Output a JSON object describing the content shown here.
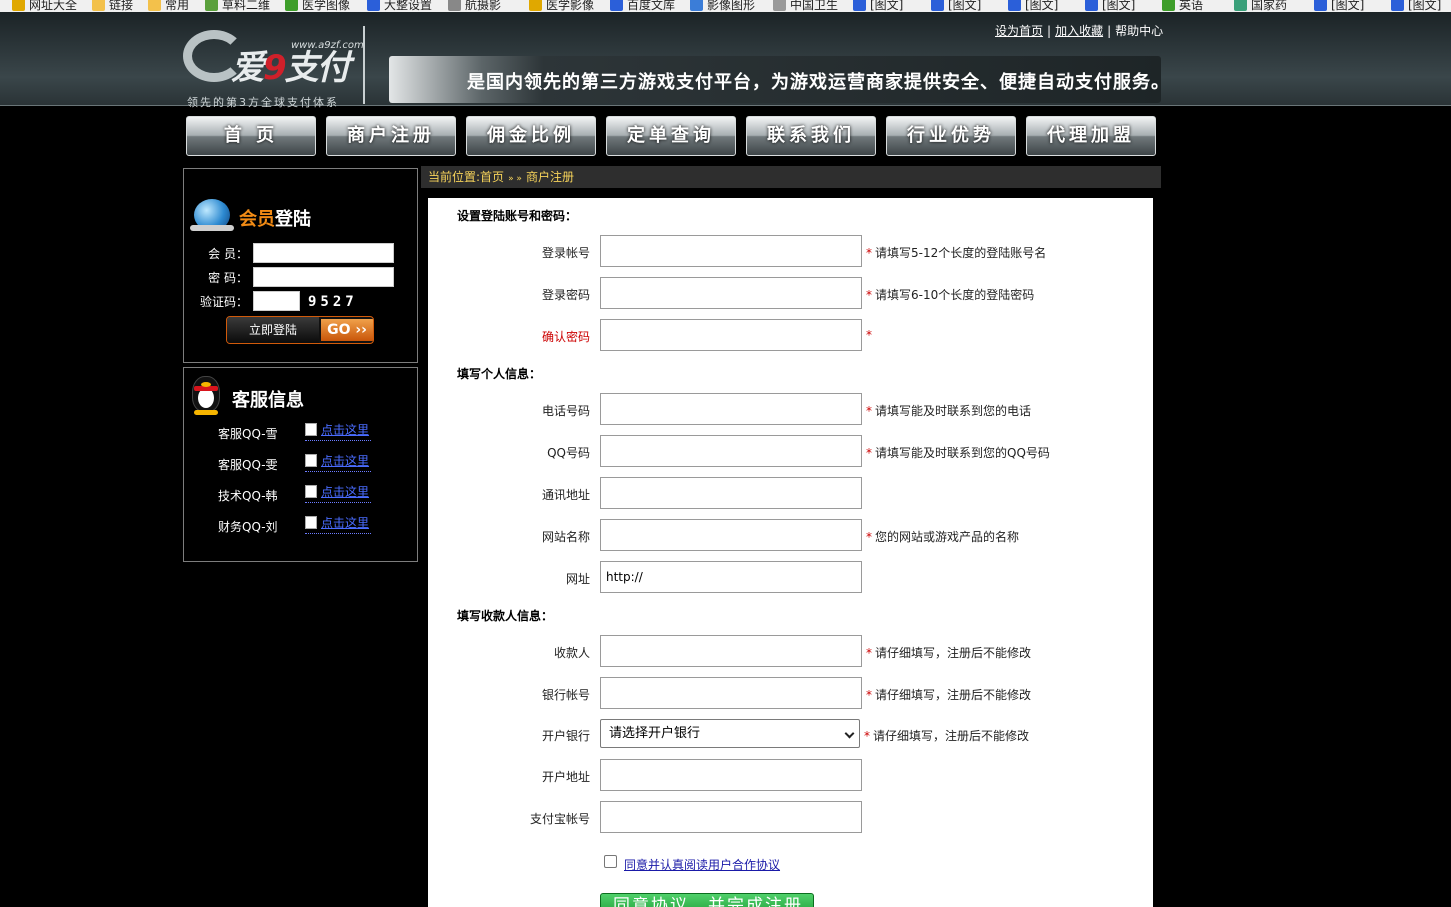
{
  "bookmarks": [
    {
      "label": "网址大全",
      "icon": "globe-icon",
      "color": "#e0a800"
    },
    {
      "label": "链接",
      "icon": "folder-icon",
      "color": "#f3c14b"
    },
    {
      "label": "常用",
      "icon": "folder-icon",
      "color": "#f3c14b"
    },
    {
      "label": "草料二维",
      "icon": "qr-icon",
      "color": "#5aa03c"
    },
    {
      "label": "医学图像",
      "icon": "leaf-icon",
      "color": "#3e9e2a"
    },
    {
      "label": "大整设置",
      "icon": "user-icon",
      "color": "#2b5fd9"
    },
    {
      "label": "航摄影",
      "icon": "disc-icon",
      "color": "#888888"
    },
    {
      "label": "医学影像",
      "icon": "wand-icon",
      "color": "#e0a800"
    },
    {
      "label": "百度文库",
      "icon": "user-icon",
      "color": "#2b5fd9"
    },
    {
      "label": "影像图形",
      "icon": "chart-icon",
      "color": "#3b7dd8"
    },
    {
      "label": "中国卫生",
      "icon": "disc-icon",
      "color": "#999999"
    },
    {
      "label": "[图文]",
      "icon": "user-icon",
      "color": "#2b5fd9"
    },
    {
      "label": "[图文]",
      "icon": "user-icon",
      "color": "#2b5fd9"
    },
    {
      "label": "[图文]",
      "icon": "user-icon",
      "color": "#2b5fd9"
    },
    {
      "label": "[图文]",
      "icon": "user-icon",
      "color": "#2b5fd9"
    },
    {
      "label": "英语",
      "icon": "leaf-icon",
      "color": "#3e9e2a"
    },
    {
      "label": "国家药",
      "icon": "gear-icon",
      "color": "#3aa07a"
    },
    {
      "label": "[图文]",
      "icon": "user-icon",
      "color": "#2b5fd9"
    },
    {
      "label": "[图文]",
      "icon": "user-icon",
      "color": "#2b5fd9"
    }
  ],
  "header": {
    "logo_text_pre": "爱",
    "logo_text_nine": "9",
    "logo_text_post": "支付",
    "logo_url": "www.a9zf.com",
    "logo_slogan": "领先的第3方全球支付体系",
    "links": {
      "home": "设为首页",
      "favorite": "加入收藏",
      "help": "帮助中心",
      "sep": "|"
    },
    "banner_text": "是国内领先的第三方游戏支付平台，为游戏运营商家提供安全、便捷自动支付服务。"
  },
  "nav": [
    "首 页",
    "商户注册",
    "佣金比例",
    "定单查询",
    "联系我们",
    "行业优势",
    "代理加盟"
  ],
  "login_panel": {
    "title_a": "会员",
    "title_b": "登陆",
    "member_label": "会 员：",
    "password_label": "密 码：",
    "captcha_label": "验证码：",
    "captcha_text": "9527",
    "login_button": "立即登陆",
    "go_button": "GO ››"
  },
  "service_panel": {
    "title": "客服信息",
    "items": [
      {
        "label": "客服QQ-雪",
        "link": "点击这里"
      },
      {
        "label": "客服QQ-雯",
        "link": "点击这里"
      },
      {
        "label": "技术QQ-韩",
        "link": "点击这里"
      },
      {
        "label": "财务QQ-刘",
        "link": "点击这里"
      }
    ]
  },
  "breadcrumb": {
    "prefix": "当前位置:",
    "home": "首页",
    "arrow": "» »",
    "current": "商户注册"
  },
  "form": {
    "section1": "设置登陆账号和密码：",
    "section2": "填写个人信息：",
    "section3": "填写收款人信息：",
    "fields": {
      "login_account": {
        "label": "登录帐号",
        "value": "",
        "hint": "请填写5-12个长度的登陆账号名"
      },
      "login_password": {
        "label": "登录密码",
        "value": "",
        "hint": "请填写6-10个长度的登陆密码"
      },
      "confirm_password": {
        "label": "确认密码",
        "value": "",
        "hint": ""
      },
      "phone": {
        "label": "电话号码",
        "value": "",
        "hint": "请填写能及时联系到您的电话"
      },
      "qq": {
        "label": "QQ号码",
        "value": "",
        "hint": "请填写能及时联系到您的QQ号码"
      },
      "address": {
        "label": "通讯地址",
        "value": ""
      },
      "site_name": {
        "label": "网站名称",
        "value": "",
        "hint": "您的网站或游戏产品的名称"
      },
      "site_url": {
        "label": "网址",
        "value": "http://"
      },
      "payee": {
        "label": "收款人",
        "value": "",
        "hint": "请仔细填写，注册后不能修改"
      },
      "bank_account": {
        "label": "银行帐号",
        "value": "",
        "hint": "请仔细填写，注册后不能修改"
      },
      "bank": {
        "label": "开户银行",
        "value": "请选择开户银行",
        "hint": "请仔细填写，注册后不能修改"
      },
      "bank_address": {
        "label": "开户地址",
        "value": ""
      },
      "alipay": {
        "label": "支付宝帐号",
        "value": ""
      }
    },
    "star": "*",
    "agree_text": "同意并认真阅读用户合作协议",
    "submit": "同意协议，并完成注册"
  }
}
